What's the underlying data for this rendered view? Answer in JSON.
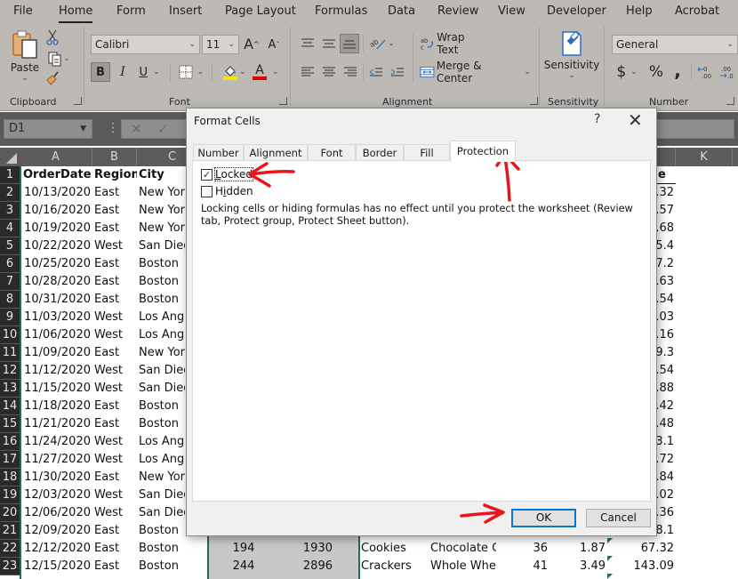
{
  "menu": {
    "tabs": [
      "File",
      "Home",
      "Form",
      "Insert",
      "Page Layout",
      "Formulas",
      "Data",
      "Review",
      "View",
      "Developer",
      "Help",
      "Acrobat"
    ],
    "active": "Home"
  },
  "ribbon": {
    "clipboard": {
      "paste_label": "Paste",
      "group_label": "Clipboard"
    },
    "font": {
      "font_name": "Calibri",
      "font_size": "11",
      "bold": "B",
      "italic": "I",
      "underline": "U",
      "grow": "A",
      "shrink": "A",
      "font_color_letter": "A",
      "group_label": "Font",
      "fill_color": "#f5e600",
      "font_color": "#e00000"
    },
    "alignment": {
      "wrap_text": "Wrap Text",
      "merge_center": "Merge & Center",
      "group_label": "Alignment"
    },
    "sensitivity": {
      "label": "Sensitivity",
      "group_label": "Sensitivity"
    },
    "number": {
      "format": "General",
      "currency": "$",
      "percent": "%",
      "comma": ",",
      "inc_decimal": "←0 .00",
      "dec_decimal": ".00 →0",
      "group_label": "Number"
    }
  },
  "formula_bar": {
    "name_box": "D1",
    "cancel_icon": "✕",
    "enter_icon": "✓"
  },
  "grid": {
    "columns": [
      "A",
      "B",
      "C",
      "K"
    ],
    "headers": {
      "A": "OrderDate",
      "B": "Region",
      "C": "City",
      "J": "e"
    },
    "rows": [
      {
        "n": "1"
      },
      {
        "n": "2",
        "date": "10/13/2020",
        "region": "East",
        "city": "New York",
        "j": ".32"
      },
      {
        "n": "3",
        "date": "10/16/2020",
        "region": "East",
        "city": "New York",
        "j": ".57"
      },
      {
        "n": "4",
        "date": "10/19/2020",
        "region": "East",
        "city": "New York",
        "j": ".68"
      },
      {
        "n": "5",
        "date": "10/22/2020",
        "region": "West",
        "city": "San Diego",
        "j": "5.4"
      },
      {
        "n": "6",
        "date": "10/25/2020",
        "region": "East",
        "city": "Boston",
        "j": "7.2"
      },
      {
        "n": "7",
        "date": "10/28/2020",
        "region": "East",
        "city": "Boston",
        "j": ".63"
      },
      {
        "n": "8",
        "date": "10/31/2020",
        "region": "East",
        "city": "Boston",
        "j": ".54"
      },
      {
        "n": "9",
        "date": "11/03/2020",
        "region": "West",
        "city": "Los Angeles",
        "j": ".03"
      },
      {
        "n": "10",
        "date": "11/06/2020",
        "region": "West",
        "city": "Los Angeles",
        "j": ".16"
      },
      {
        "n": "11",
        "date": "11/09/2020",
        "region": "East",
        "city": "New York",
        "j": "9.3"
      },
      {
        "n": "12",
        "date": "11/12/2020",
        "region": "West",
        "city": "San Diego",
        "j": ".54"
      },
      {
        "n": "13",
        "date": "11/15/2020",
        "region": "West",
        "city": "San Diego",
        "j": ".88"
      },
      {
        "n": "14",
        "date": "11/18/2020",
        "region": "East",
        "city": "Boston",
        "j": ".42"
      },
      {
        "n": "15",
        "date": "11/21/2020",
        "region": "East",
        "city": "Boston",
        "j": ".48"
      },
      {
        "n": "16",
        "date": "11/24/2020",
        "region": "West",
        "city": "Los Angeles",
        "j": "3.1"
      },
      {
        "n": "17",
        "date": "11/27/2020",
        "region": "West",
        "city": "Los Angeles",
        "j": ".72"
      },
      {
        "n": "18",
        "date": "11/30/2020",
        "region": "East",
        "city": "New York",
        "j": ".84"
      },
      {
        "n": "19",
        "date": "12/03/2020",
        "region": "West",
        "city": "San Diego",
        "j": ".02"
      },
      {
        "n": "20",
        "date": "12/06/2020",
        "region": "West",
        "city": "San Diego",
        "j": ".36"
      },
      {
        "n": "21",
        "date": "12/09/2020",
        "region": "East",
        "city": "Boston",
        "j": "8.1"
      },
      {
        "n": "22",
        "date": "12/12/2020",
        "region": "East",
        "city": "Boston",
        "d": "194",
        "e": "1930",
        "f": "Cookies",
        "g": "Chocolate Chip",
        "h": "36",
        "i": "1.87",
        "j": "67.32"
      },
      {
        "n": "23",
        "date": "12/15/2020",
        "region": "East",
        "city": "Boston",
        "d": "244",
        "e": "2896",
        "f": "Crackers",
        "g": "Whole Wheat",
        "h": "41",
        "i": "3.49",
        "j": "143.09"
      }
    ]
  },
  "dialog": {
    "title": "Format Cells",
    "help": "?",
    "close": "✕",
    "tabs": [
      "Number",
      "Alignment",
      "Font",
      "Border",
      "Fill",
      "Protection"
    ],
    "active_tab": "Protection",
    "locked_label": "Locked",
    "locked_checked": true,
    "hidden_label": "Hidden",
    "hidden_checked": false,
    "note": "Locking cells or hiding formulas has no effect until you protect the worksheet (Review tab, Protect group, Protect Sheet button).",
    "ok": "OK",
    "cancel": "Cancel"
  },
  "annotation_color": "#e8161b"
}
